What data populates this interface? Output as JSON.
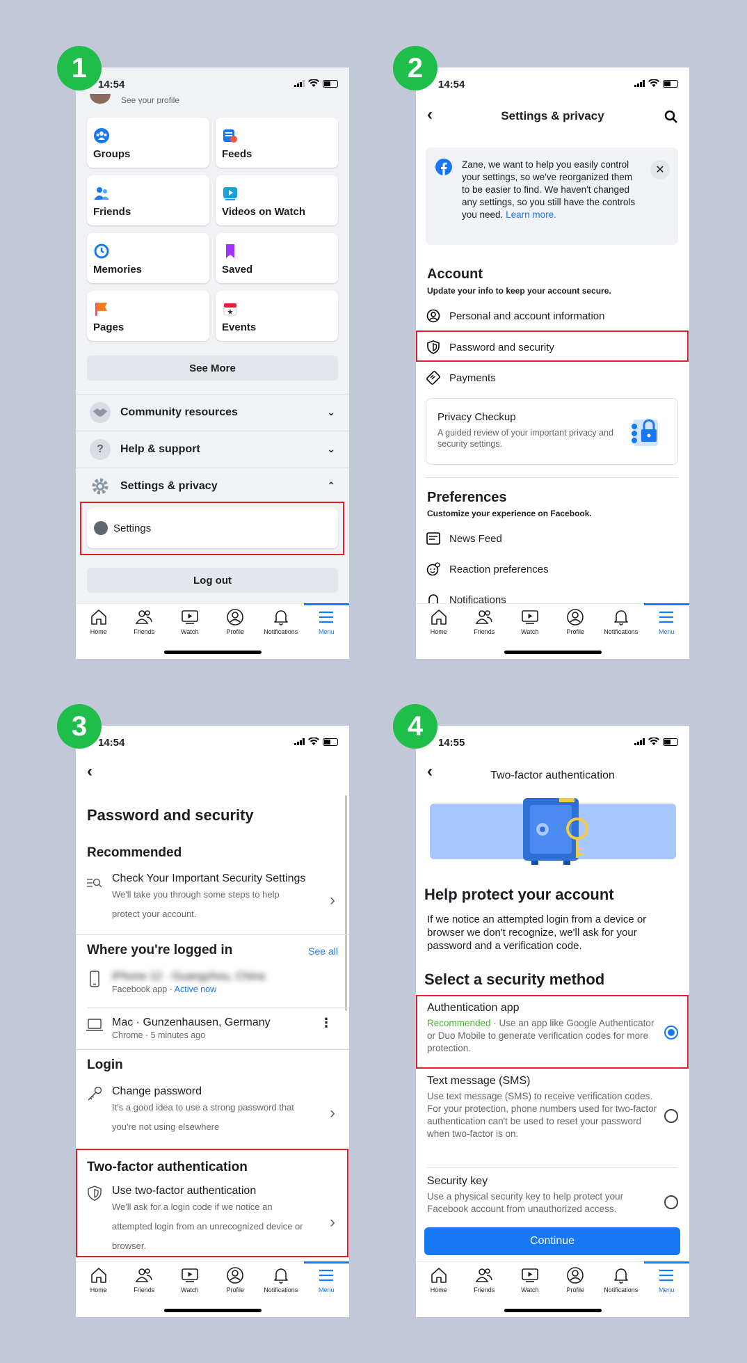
{
  "badges": [
    "1",
    "2",
    "3",
    "4"
  ],
  "tabs": [
    {
      "label": "Home",
      "icon": "home-icon"
    },
    {
      "label": "Friends",
      "icon": "friends-icon"
    },
    {
      "label": "Watch",
      "icon": "watch-icon"
    },
    {
      "label": "Profile",
      "icon": "profile-icon"
    },
    {
      "label": "Notifications",
      "icon": "bell-icon"
    },
    {
      "label": "Menu",
      "icon": "menu-icon"
    }
  ],
  "screen1": {
    "time": "14:54",
    "profile_hint": "See your profile",
    "shortcuts": [
      {
        "label": "Groups",
        "icon": "groups-icon",
        "color": "#1877f2"
      },
      {
        "label": "Feeds",
        "icon": "feeds-icon",
        "color": "#1877f2"
      },
      {
        "label": "Friends",
        "icon": "friends-icon",
        "color": "#1877f2"
      },
      {
        "label": "Videos on Watch",
        "icon": "watch-icon",
        "color": "#1ba0d8"
      },
      {
        "label": "Memories",
        "icon": "clock-icon",
        "color": "#1877f2"
      },
      {
        "label": "Saved",
        "icon": "bookmark-icon",
        "color": "#a033ff"
      },
      {
        "label": "Pages",
        "icon": "flag-icon",
        "color": "#f35369"
      },
      {
        "label": "Events",
        "icon": "calendar-icon",
        "color": "#e41e3f"
      }
    ],
    "see_more": "See More",
    "community": "Community resources",
    "help": "Help & support",
    "settings_privacy": "Settings & privacy",
    "settings": "Settings",
    "logout": "Log out"
  },
  "screen2": {
    "time": "14:54",
    "title": "Settings & privacy",
    "info": "Zane, we want to help you easily control your settings, so we've reorganized them to be easier to find. We haven't changed any settings, so you still have the controls you need.",
    "learn_more": "Learn more.",
    "account_title": "Account",
    "account_sub": "Update your info to keep your account secure.",
    "personal": "Personal and account information",
    "password": "Password and security",
    "payments": "Payments",
    "privacy_title": "Privacy Checkup",
    "privacy_desc": "A guided review of your important privacy and security settings.",
    "prefs_title": "Preferences",
    "prefs_sub": "Customize your experience on Facebook.",
    "newsfeed": "News Feed",
    "reaction": "Reaction preferences",
    "notifications": "Notifications"
  },
  "screen3": {
    "time": "14:54",
    "title": "Password and security",
    "recommended": "Recommended",
    "check_title": "Check Your Important Security Settings",
    "check_desc": "We'll take you through some steps to help protect your account.",
    "logged_in": "Where you're logged in",
    "see_all": "See all",
    "device1": "iPhone 12 · Guangzhou, China",
    "device1_sub": "Facebook app · ",
    "active_now": "Active now",
    "device2": "Mac · Gunzenhausen, Germany",
    "device2_sub": "Chrome · 5 minutes ago",
    "login": "Login",
    "change_pw": "Change password",
    "change_pw_desc": "It's a good idea to use a strong password that you're not using elsewhere",
    "tfa": "Two-factor authentication",
    "use_tfa": "Use two-factor authentication",
    "use_tfa_desc": "We'll ask for a login code if we notice an attempted login from an unrecognized device or browser."
  },
  "screen4": {
    "time": "14:55",
    "title": "Two-factor authentication",
    "heading": "Help protect your account",
    "intro": "If we notice an attempted login from a device or browser we don't recognize, we'll ask for your password and a verification code.",
    "select": "Select a security method",
    "auth_app": "Authentication app",
    "recommended": "Recommended",
    "auth_app_desc": " · Use an app like Google Authenticator or Duo Mobile to generate verification codes for more protection.",
    "sms": "Text message (SMS)",
    "sms_desc": "Use text message (SMS) to receive verification codes. For your protection, phone numbers used for two-factor authentication can't be used to reset your password when two-factor is on.",
    "key": "Security key",
    "key_desc": "Use a physical security key to help protect your Facebook account from unauthorized access.",
    "continue": "Continue"
  }
}
